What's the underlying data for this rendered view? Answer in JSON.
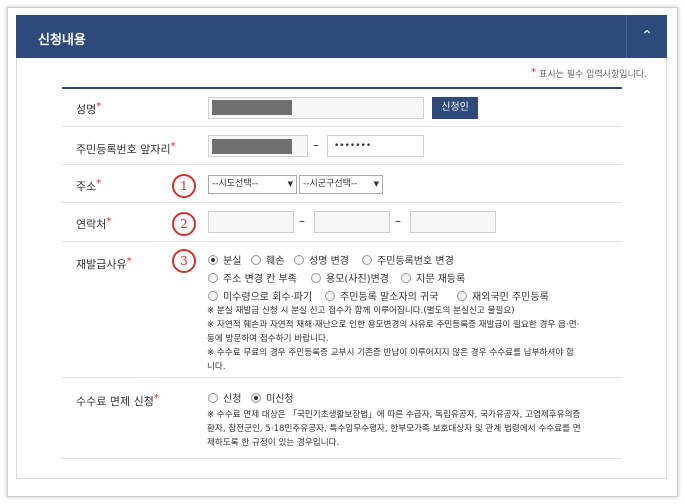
{
  "header": {
    "title": "신청내용",
    "collapse_icon": "chevron-up-icon"
  },
  "required_note": "표시는 필수 입력사항입니다.",
  "required_mark": "*",
  "fields": {
    "name": {
      "label": "성명",
      "apply_button": "신청인"
    },
    "rrn": {
      "label": "주민등록번호 앞자리",
      "back_value": "•••••••",
      "separator": "–"
    },
    "address": {
      "label": "주소",
      "step": "1",
      "sido_select": "--시도선택--",
      "sigungu_select": "--시군구선택--"
    },
    "contact": {
      "label": "연락처",
      "step": "2",
      "separator": "–"
    },
    "reason": {
      "label": "재발급사유",
      "step": "3",
      "options": [
        "분실",
        "훼손",
        "성명 변경",
        "주민등록번호 변경",
        "주소 변경 칸 부족",
        "용모(사진)변경",
        "지문 재등록",
        "미수령으로 회수·파기",
        "주민등록 말소자의 귀국",
        "재외국민 주민등록"
      ],
      "selected": "분실",
      "notes": [
        "※ 분실 재발급 신청 시 분실 신고 접수가 함께 이루어집니다.(별도의 분실신고 불필요)",
        "※ 자연적 훼손과 자연적 재해·재난으로 인한 용모변경의 사유로 주민등록증 재발급이 필요한 경우 읍·면·",
        "동에 방문하여 접수하기 바랍니다.",
        "※ 수수료 무료의 경우 주민등록증 교부시 기존증 반납이 이루어지지 않은 경우 수수료를 납부하셔야 합",
        "니다."
      ]
    },
    "fee_exemption": {
      "label": "수수료 면제 신청",
      "options": [
        "신청",
        "미신청"
      ],
      "selected": "미신청",
      "notes": [
        "※ 수수료 면제 대상은 「국민기초생활보장법」에 따른 수급자, 독립유공자, 국가유공자, 고엽제후유의증",
        "환자, 참전군인, 5·18민주유공자, 특수임무수행자, 한부모가족 보호대상자 및 관계 법령에서 수수료를 면",
        "제하도록 한 규정이 있는 경우입니다."
      ]
    }
  },
  "colors": {
    "header_bg": "#2d4a7a",
    "required": "#e02020",
    "step_circle": "#d0342c",
    "masked": "#707070"
  }
}
